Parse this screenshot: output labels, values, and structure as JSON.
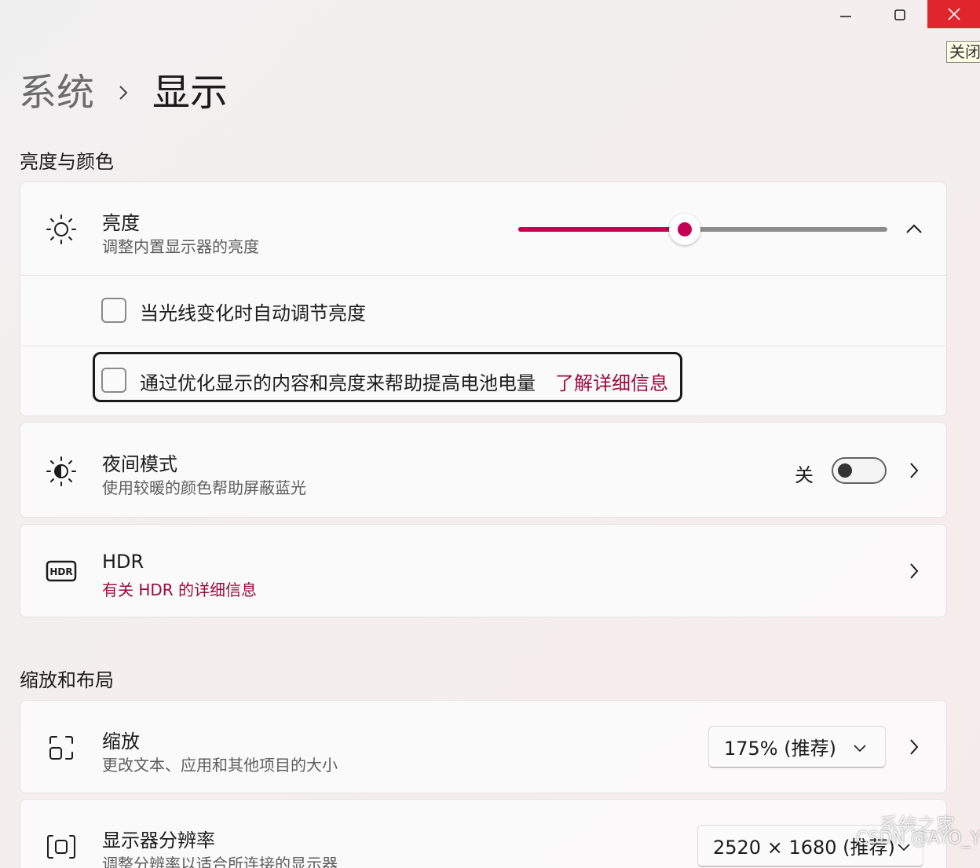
{
  "window": {
    "close_tooltip": "关闭"
  },
  "breadcrumb": {
    "parent": "系统",
    "current": "显示"
  },
  "section_brightness": {
    "title": "亮度与颜色",
    "brightness": {
      "title": "亮度",
      "subtitle": "调整内置显示器的亮度",
      "level_percent": 45,
      "accent": "#c30052"
    },
    "auto_adjust_label": "当光线变化时自动调节亮度",
    "auto_adjust_checked": false,
    "battery_label": "通过优化显示的内容和亮度来帮助提高电池电量",
    "battery_link": "了解详细信息",
    "battery_checked": false
  },
  "night_light": {
    "title": "夜间模式",
    "subtitle": "使用较暖的颜色帮助屏蔽蓝光",
    "state_label": "关",
    "on": false
  },
  "hdr": {
    "title": "HDR",
    "link": "有关 HDR 的详细信息"
  },
  "section_scale": {
    "title": "缩放和布局",
    "scale": {
      "title": "缩放",
      "subtitle": "更改文本、应用和其他项目的大小",
      "value": "175% (推荐)"
    },
    "resolution": {
      "title": "显示器分辨率",
      "subtitle": "调整分辨率以适合所连接的显示器",
      "value": "2520 × 1680 (推荐)"
    }
  },
  "watermark": {
    "line1": "系统之家",
    "line2": "CSDN @AYO_YO"
  }
}
